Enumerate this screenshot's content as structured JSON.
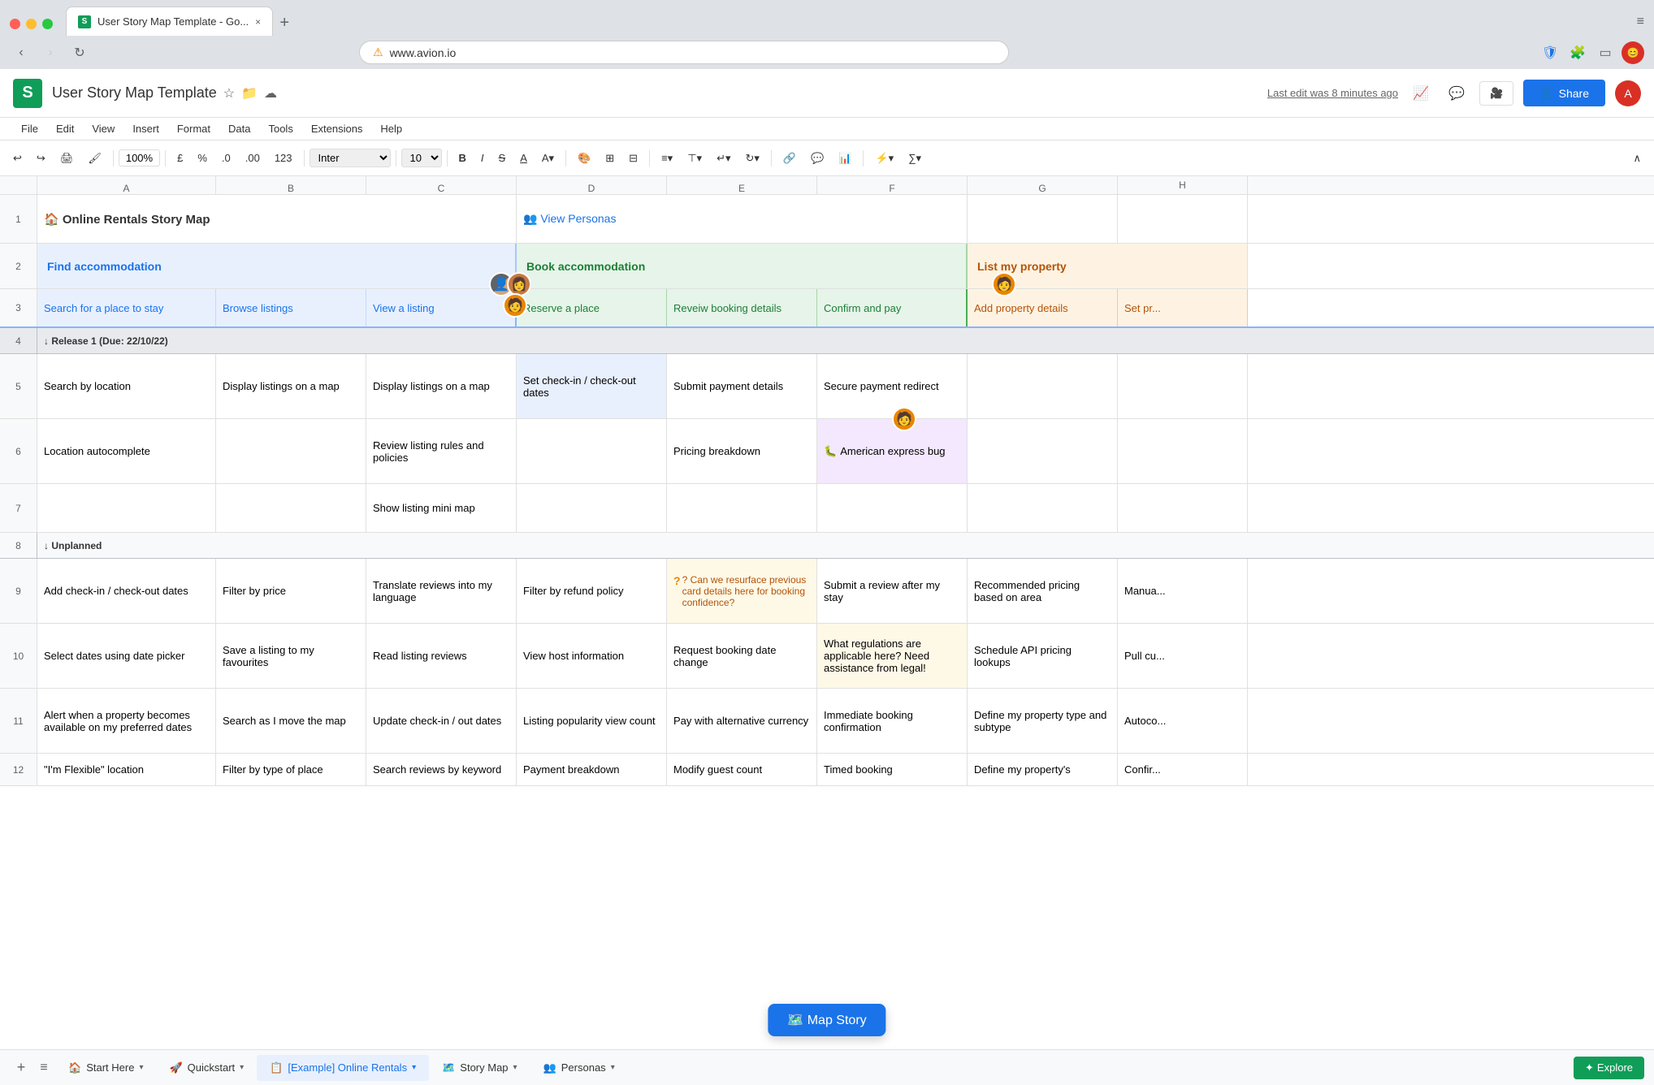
{
  "browser": {
    "tab_title": "User Story Map Template - Go...",
    "url": "www.avion.io",
    "new_tab_label": "+",
    "close_label": "×"
  },
  "sheets": {
    "doc_title": "User Story Map Template",
    "last_edit": "Last edit was 8 minutes ago",
    "share_label": "Share",
    "menu": [
      "File",
      "Edit",
      "View",
      "Insert",
      "Format",
      "Data",
      "Tools",
      "Extensions",
      "Help"
    ],
    "font": "Inter",
    "font_size": "10",
    "zoom": "100%"
  },
  "spreadsheet": {
    "col_headers": [
      "A",
      "B",
      "C",
      "D",
      "E",
      "F",
      "G"
    ],
    "row1": {
      "title": "🏠 Online Rentals Story Map",
      "view_personas": "👥 View Personas"
    },
    "row2": {
      "col_a": "Find accommodation",
      "col_d": "Book accommodation",
      "col_g": "List my property"
    },
    "row3": {
      "col_a": "Search for a place to stay",
      "col_b": "Browse listings",
      "col_c": "View a listing",
      "col_d": "Reserve a place",
      "col_e": "Reveiw booking details",
      "col_f": "Confirm and pay",
      "col_g": "Add property details",
      "col_h": "Set pr..."
    },
    "row4": {
      "release": "↓ Release 1 (Due: 22/10/22)"
    },
    "row5": {
      "col_a": "Search by location",
      "col_b": "Display listings on a map",
      "col_c": "Display listings on a map",
      "col_d": "Set check-in / check-out dates",
      "col_e": "Submit payment details",
      "col_f": "Secure payment redirect"
    },
    "row6": {
      "col_a": "Location autocomplete",
      "col_c": "Review listing rules and policies",
      "col_e": "Pricing breakdown",
      "col_f": "American express bug"
    },
    "row7": {
      "col_c": "Show listing mini map"
    },
    "row8": {
      "unplanned": "↓ Unplanned"
    },
    "row9": {
      "col_a": "Add check-in / check-out dates",
      "col_b": "Filter by price",
      "col_c": "Translate reviews into my language",
      "col_d": "Filter by refund policy",
      "col_e": "? Can we resurface previous card details here for booking confidence?",
      "col_f": "Submit a review after my stay",
      "col_g": "Recommended pricing based on area",
      "col_h": "Manua..."
    },
    "row10": {
      "col_a": "Select dates using date picker",
      "col_b": "Save a listing to my favourites",
      "col_c": "Read listing reviews",
      "col_d": "View host information",
      "col_e": "Request booking date change",
      "col_f": "What regulations are applicable here? Need assistance from legal!",
      "col_g": "Schedule API pricing lookups",
      "col_h": "Pull cu..."
    },
    "row11": {
      "col_a": "Alert when a property becomes available on my preferred dates",
      "col_b": "Search as I move the map",
      "col_c": "Update check-in / out dates",
      "col_d": "Listing popularity view count",
      "col_e": "Pay with alternative currency",
      "col_f": "Immediate booking confirmation",
      "col_g": "Define my property type and subtype",
      "col_h": "Autoco..."
    },
    "row12": {
      "col_a": "\"I'm Flexible\" location",
      "col_b": "Filter by type of place",
      "col_c": "Search reviews by keyword",
      "col_d": "Payment breakdown",
      "col_e": "Modify guest count",
      "col_f": "Timed booking",
      "col_g": "Define my property's",
      "col_h": "Confir..."
    }
  },
  "bottom_tabs": {
    "add": "+",
    "list_icon": "≡",
    "tabs": [
      {
        "label": "Start Here",
        "icon": "🏠",
        "active": false
      },
      {
        "label": "Quickstart",
        "icon": "🚀",
        "active": false
      },
      {
        "label": "[Example] Online Rentals",
        "icon": "📋",
        "active": true
      },
      {
        "label": "Story Map",
        "icon": "🗺️",
        "active": false
      },
      {
        "label": "Personas",
        "icon": "👥",
        "active": false
      }
    ],
    "explore": "Explore"
  }
}
